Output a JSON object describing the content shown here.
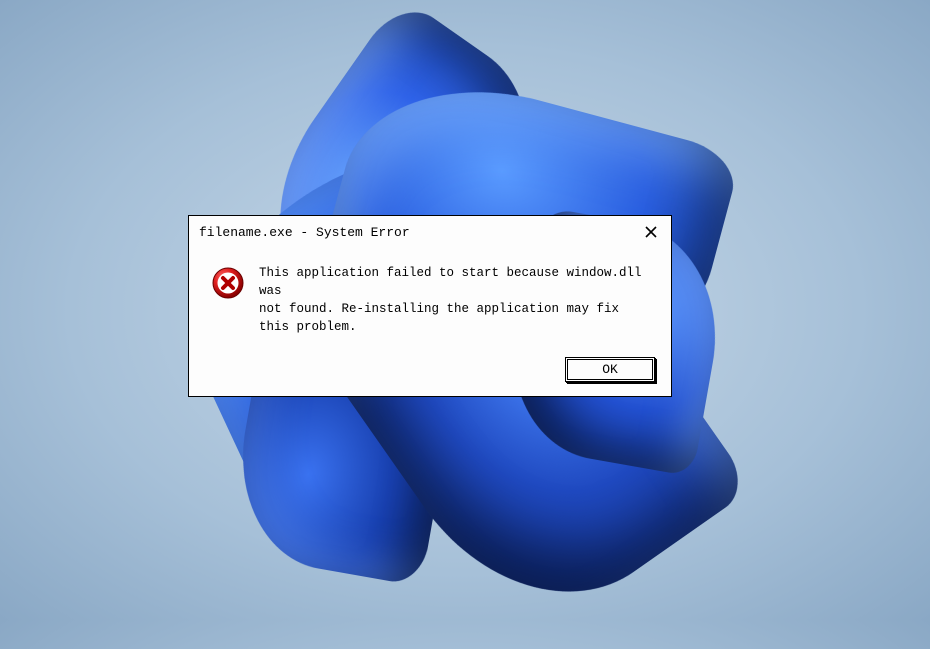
{
  "dialog": {
    "title": "filename.exe - System Error",
    "message": "This application failed to start because window.dll was\nnot found. Re-installing the application may fix this problem.",
    "ok_label": "OK",
    "icon": "error-icon"
  }
}
